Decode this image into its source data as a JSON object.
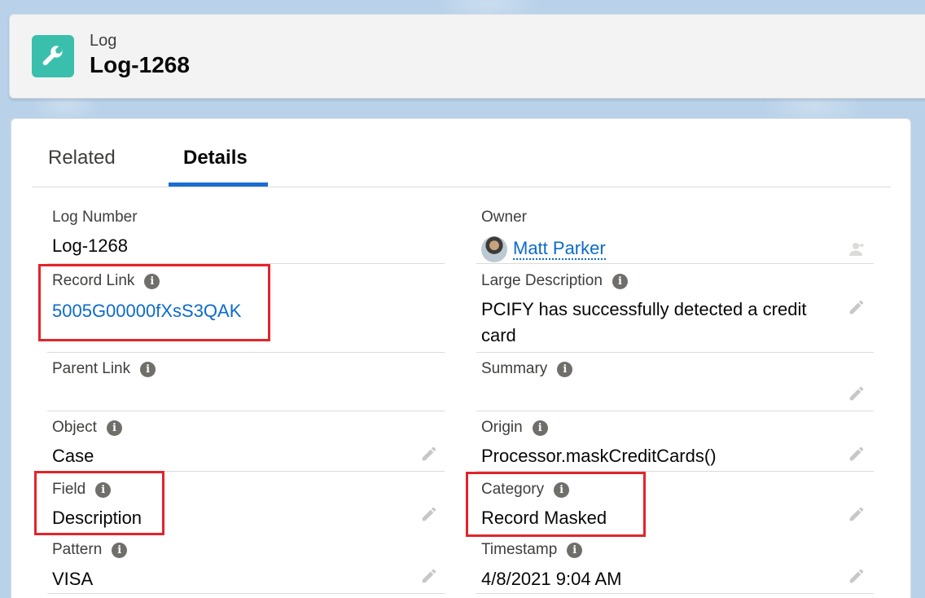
{
  "header": {
    "object_label": "Log",
    "record_title": "Log-1268",
    "icon": "wrench-icon",
    "icon_color": "#3bbfad"
  },
  "tabs": [
    {
      "label": "Related",
      "active": false
    },
    {
      "label": "Details",
      "active": true
    }
  ],
  "left_fields": [
    {
      "label": "Log Number",
      "value": "Log-1268",
      "info": false
    },
    {
      "label": "Record Link",
      "value": "5005G00000fXsS3QAK",
      "info": true,
      "link": true
    },
    {
      "label": "Parent Link",
      "value": "",
      "info": true
    },
    {
      "label": "Object",
      "value": "Case",
      "info": true,
      "editable": true
    },
    {
      "label": "Field",
      "value": "Description",
      "info": true,
      "editable": true
    },
    {
      "label": "Pattern",
      "value": "VISA",
      "info": true,
      "editable": true
    }
  ],
  "right_fields": [
    {
      "label": "Owner",
      "value": "Matt Parker",
      "info": false,
      "link": true
    },
    {
      "label": "Large Description",
      "value": "PCIFY has successfully detected a credit card",
      "info": true,
      "editable": true
    },
    {
      "label": "Summary",
      "value": "",
      "info": true,
      "editable": true
    },
    {
      "label": "Origin",
      "value": "Processor.maskCreditCards()",
      "info": true,
      "editable": true
    },
    {
      "label": "Category",
      "value": "Record Masked",
      "info": true,
      "editable": true
    },
    {
      "label": "Timestamp",
      "value": "4/8/2021 9:04 AM",
      "info": true,
      "editable": true
    }
  ],
  "colors": {
    "link": "#0b6bcb",
    "active_tab_underline": "#1b6dd2",
    "highlight_box": "#e3242b"
  }
}
